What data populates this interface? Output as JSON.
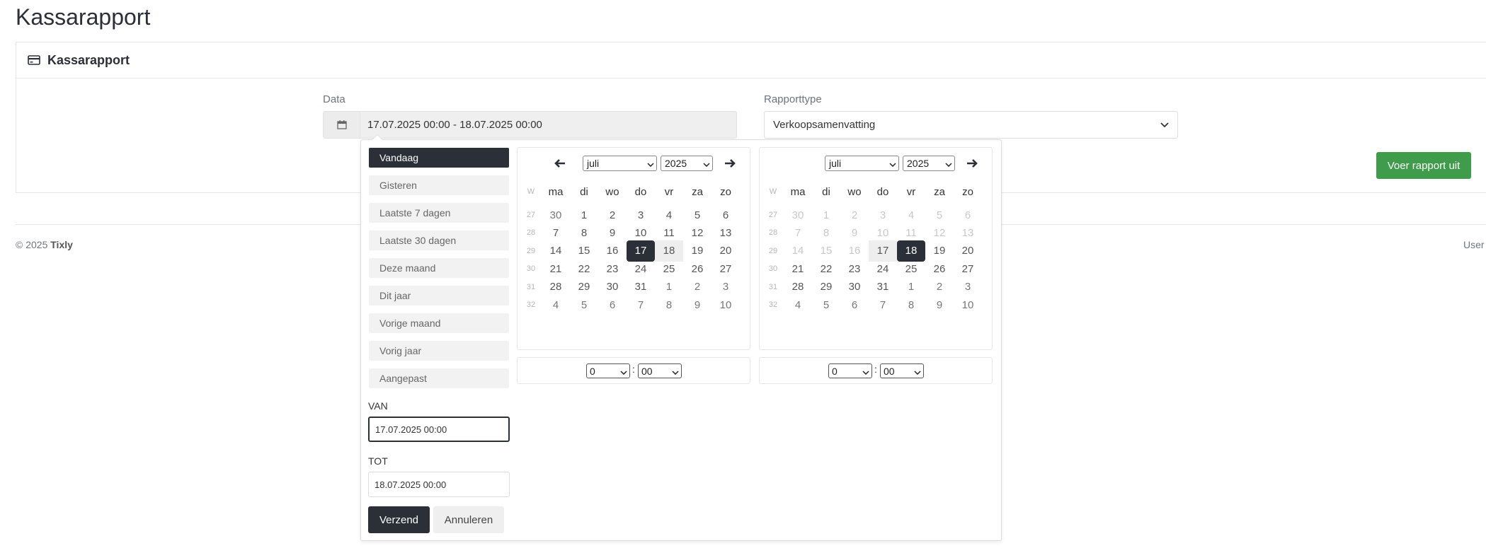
{
  "page": {
    "title": "Kassarapport"
  },
  "card": {
    "title": "Kassarapport"
  },
  "form": {
    "date_label": "Data",
    "date_value": "17.07.2025 00:00 - 18.07.2025 00:00",
    "report_type_label": "Rapporttype",
    "report_type_value": "Verkoopsamenvatting",
    "run_button": "Voer rapport uit"
  },
  "footer": {
    "copyright": "© 2025",
    "brand": "Tixly",
    "right_text": "User"
  },
  "picker": {
    "ranges": [
      "Vandaag",
      "Gisteren",
      "Laatste 7 dagen",
      "Laatste 30 dagen",
      "Deze maand",
      "Dit jaar",
      "Vorige maand",
      "Vorig jaar",
      "Aangepast"
    ],
    "active_range": "Vandaag",
    "from_label": "VAN",
    "from_value": "17.07.2025 00:00",
    "to_label": "TOT",
    "to_value": "18.07.2025 00:00",
    "submit": "Verzend",
    "cancel": "Annuleren",
    "week_header": "W",
    "weekdays": [
      "ma",
      "di",
      "wo",
      "do",
      "vr",
      "za",
      "zo"
    ],
    "left_calendar": {
      "month": "juli",
      "year": "2025",
      "selected": "17",
      "weeks": [
        {
          "wk": "27",
          "days": [
            "30",
            "1",
            "2",
            "3",
            "4",
            "5",
            "6"
          ]
        },
        {
          "wk": "28",
          "days": [
            "7",
            "8",
            "9",
            "10",
            "11",
            "12",
            "13"
          ]
        },
        {
          "wk": "29",
          "days": [
            "14",
            "15",
            "16",
            "17",
            "18",
            "19",
            "20"
          ]
        },
        {
          "wk": "30",
          "days": [
            "21",
            "22",
            "23",
            "24",
            "25",
            "26",
            "27"
          ]
        },
        {
          "wk": "31",
          "days": [
            "28",
            "29",
            "30",
            "31",
            "1",
            "2",
            "3"
          ]
        },
        {
          "wk": "32",
          "days": [
            "4",
            "5",
            "6",
            "7",
            "8",
            "9",
            "10"
          ]
        }
      ],
      "hour": "0",
      "minute": "00"
    },
    "right_calendar": {
      "month": "juli",
      "year": "2025",
      "selected": "18",
      "weeks": [
        {
          "wk": "27",
          "days": [
            "30",
            "1",
            "2",
            "3",
            "4",
            "5",
            "6"
          ]
        },
        {
          "wk": "28",
          "days": [
            "7",
            "8",
            "9",
            "10",
            "11",
            "12",
            "13"
          ]
        },
        {
          "wk": "29",
          "days": [
            "14",
            "15",
            "16",
            "17",
            "18",
            "19",
            "20"
          ]
        },
        {
          "wk": "30",
          "days": [
            "21",
            "22",
            "23",
            "24",
            "25",
            "26",
            "27"
          ]
        },
        {
          "wk": "31",
          "days": [
            "28",
            "29",
            "30",
            "31",
            "1",
            "2",
            "3"
          ]
        },
        {
          "wk": "32",
          "days": [
            "4",
            "5",
            "6",
            "7",
            "8",
            "9",
            "10"
          ]
        }
      ],
      "hour": "0",
      "minute": "00"
    }
  },
  "colors": {
    "primary_dark": "#2b3038",
    "success": "#3f9c4b",
    "range_bg": "#eeeeee"
  }
}
